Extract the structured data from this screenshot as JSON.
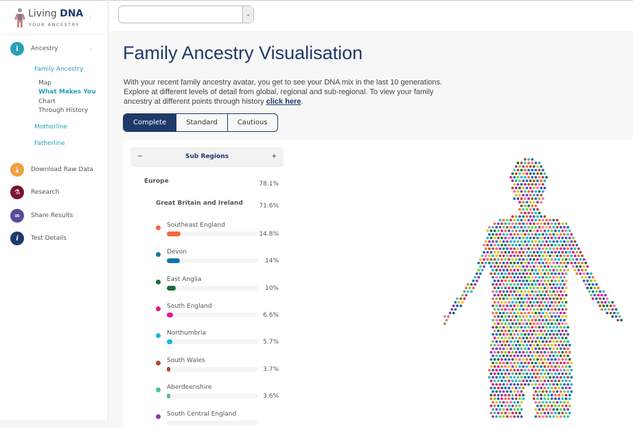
{
  "logo": {
    "brand_light": "Living",
    "brand_bold": "DNA",
    "tagline": "YOUR ANCESTRY"
  },
  "sidebar": {
    "ancestry": "Ancestry",
    "family_ancestry": "Family Ancestry",
    "sub_items": [
      "Map",
      "What Makes You",
      "Chart",
      "Through History"
    ],
    "motherline": "Motherline",
    "fatherline": "Fatherline",
    "items": [
      {
        "label": "Download Raw Data",
        "icon": "download-icon",
        "color": "#f0a040"
      },
      {
        "label": "Research",
        "icon": "flask-icon",
        "color": "#7a1230"
      },
      {
        "label": "Share Results",
        "icon": "link-icon",
        "color": "#5a4a9a"
      },
      {
        "label": "Test Details",
        "icon": "info-icon",
        "color": "#1f3a6a"
      }
    ]
  },
  "page": {
    "title": "Family Ancestry Visualisation",
    "intro": "With your recent family ancestry avatar, you get to see your DNA mix in the last 10 generations. Explore at different levels of detail from global, regional and sub-regional. To view your family ancestry at different points through history ",
    "link": "click here",
    "tabs": [
      "Complete",
      "Standard",
      "Cautious"
    ]
  },
  "panel": {
    "header": "Sub Regions",
    "minus": "−",
    "plus": "+",
    "region": {
      "name": "Europe",
      "pct": "78.1%"
    },
    "subregion": {
      "name": "Great Britain and Ireland",
      "pct": "71.6%"
    },
    "items": [
      {
        "name": "Southeast England",
        "pct": "14.8%",
        "value": 14.8,
        "color": "#f26a3c"
      },
      {
        "name": "Devon",
        "pct": "14%",
        "value": 14,
        "color": "#1573ae"
      },
      {
        "name": "East Anglia",
        "pct": "10%",
        "value": 10,
        "color": "#1a6e3a"
      },
      {
        "name": "South England",
        "pct": "6.6%",
        "value": 6.6,
        "color": "#e0168a"
      },
      {
        "name": "Northumbria",
        "pct": "5.7%",
        "value": 5.7,
        "color": "#1ab4e0"
      },
      {
        "name": "South Wales",
        "pct": "3.7%",
        "value": 3.7,
        "color": "#b04a2a"
      },
      {
        "name": "Aberdeenshire",
        "pct": "3.6%",
        "value": 3.6,
        "color": "#4cc0a0"
      },
      {
        "name": "South Central England",
        "pct": "",
        "value": 0,
        "color": "#8a3ab0"
      }
    ]
  }
}
